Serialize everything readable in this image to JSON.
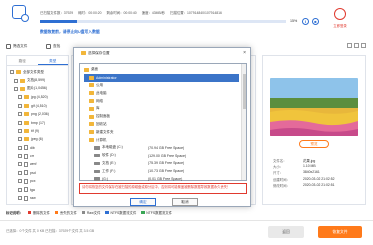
{
  "top": {
    "stats": [
      "已扫描文件数：37929",
      "耗时：00:00:20",
      "剩余时间：00:00:40",
      "速度：43MB/秒",
      "扫描位置：107914840/107914816"
    ],
    "progress_percent": 15,
    "progress_label": "15%",
    "tip": "数据恢复前，请停止向U盘写入数据",
    "login_label": "立即登录"
  },
  "toolbar": {
    "filter_label": "筛选文件",
    "search_label": "查找"
  },
  "left": {
    "tabs": [
      "路径",
      "类型"
    ],
    "tree": [
      {
        "label": "全部文件类型",
        "indent": 0,
        "kind": "folder"
      },
      {
        "label": "文档(8,599)",
        "indent": 1,
        "kind": "folder"
      },
      {
        "label": "图片(1,0456)",
        "indent": 1,
        "kind": "folder"
      },
      {
        "label": "jpg (4,520)",
        "indent": 2,
        "kind": "folder"
      },
      {
        "label": "gif (4,510)",
        "indent": 2,
        "kind": "folder"
      },
      {
        "label": "png (2,036)",
        "indent": 2,
        "kind": "folder"
      },
      {
        "label": "bmp (17)",
        "indent": 2,
        "kind": "folder"
      },
      {
        "label": "tif (9)",
        "indent": 2,
        "kind": "folder"
      },
      {
        "label": "jpeg (6)",
        "indent": 2,
        "kind": "folder"
      },
      {
        "label": "dib",
        "indent": 2,
        "kind": "doc"
      },
      {
        "label": "crr",
        "indent": 2,
        "kind": "doc"
      },
      {
        "label": "wmf",
        "indent": 2,
        "kind": "doc"
      },
      {
        "label": "psd",
        "indent": 2,
        "kind": "doc"
      },
      {
        "label": "pcx",
        "indent": 2,
        "kind": "doc"
      },
      {
        "label": "tga",
        "indent": 2,
        "kind": "doc"
      },
      {
        "label": "raw",
        "indent": 2,
        "kind": "doc"
      }
    ]
  },
  "dialog": {
    "title": "选择保存位置",
    "rows": [
      {
        "label": "桌面",
        "indent": 0,
        "free": "",
        "selected": false,
        "kind": "folder"
      },
      {
        "label": "Administrator",
        "indent": 1,
        "free": "",
        "selected": true,
        "kind": "folder"
      },
      {
        "label": "公用",
        "indent": 1,
        "free": "",
        "selected": false,
        "kind": "folder"
      },
      {
        "label": "此电脑",
        "indent": 1,
        "free": "",
        "selected": false,
        "kind": "folder"
      },
      {
        "label": "网络",
        "indent": 1,
        "free": "",
        "selected": false,
        "kind": "folder"
      },
      {
        "label": "库",
        "indent": 1,
        "free": "",
        "selected": false,
        "kind": "folder"
      },
      {
        "label": "控制面板",
        "indent": 1,
        "free": "",
        "selected": false,
        "kind": "folder"
      },
      {
        "label": "回收站",
        "indent": 1,
        "free": "",
        "selected": false,
        "kind": "folder"
      },
      {
        "label": "新建文件夹",
        "indent": 1,
        "free": "",
        "selected": false,
        "kind": "folder"
      },
      {
        "label": "计算机",
        "indent": 1,
        "free": "",
        "selected": false,
        "kind": "folder"
      },
      {
        "label": "本地磁盘 (C:)",
        "indent": 2,
        "free": "(70.94 GB Free Space)",
        "selected": false,
        "kind": "drive"
      },
      {
        "label": "软件 (D:)",
        "indent": 2,
        "free": "(129.00 GB Free Space)",
        "selected": false,
        "kind": "drive"
      },
      {
        "label": "文档 (E:)",
        "indent": 2,
        "free": "(75.39 GB Free Space)",
        "selected": false,
        "kind": "drive"
      },
      {
        "label": "工作 (F:)",
        "indent": 2,
        "free": "(10.73 GB Free Space)",
        "selected": false,
        "kind": "drive"
      },
      {
        "label": "(G:)",
        "indent": 2,
        "free": "(0.01 GB Free Space)",
        "selected": false,
        "kind": "drive"
      }
    ],
    "warning": "请勿将恢复的文件保存在被扫描的原磁盘或原分区中，否则将可能覆盖被删除数据导致数据永久丢失！",
    "ok_label": "确定",
    "cancel_label": "取消"
  },
  "preview": {
    "button_label": "预览",
    "meta": [
      {
        "k": "文件名：",
        "v": "花果.jpg"
      },
      {
        "k": "大小：",
        "v": "1.10 MB"
      },
      {
        "k": "尺寸：",
        "v": "3840x2161"
      },
      {
        "k": "创建时间：",
        "v": "2020-03-02 21:02:52"
      },
      {
        "k": "修改时间：",
        "v": "2020-03-02 21:02:51"
      }
    ]
  },
  "legend": {
    "title": "标记说明：",
    "items": [
      {
        "label": "删除的文件",
        "color": "#e03a2f"
      },
      {
        "label": "丢失的文件",
        "color": "#ff7a1a"
      },
      {
        "label": "Raw文件",
        "color": "#8a8a8a"
      },
      {
        "label": "NTFS数据流文件",
        "color": "#2e6fd3"
      },
      {
        "label": "NTFS数据流文件",
        "color": "#3aa655"
      }
    ]
  },
  "bottom": {
    "info": "已选择：0个文件 共 0 KB    已扫描：37929个文件 共 3.5 GB",
    "back_label": "返回",
    "recover_label": "恢复文件"
  }
}
